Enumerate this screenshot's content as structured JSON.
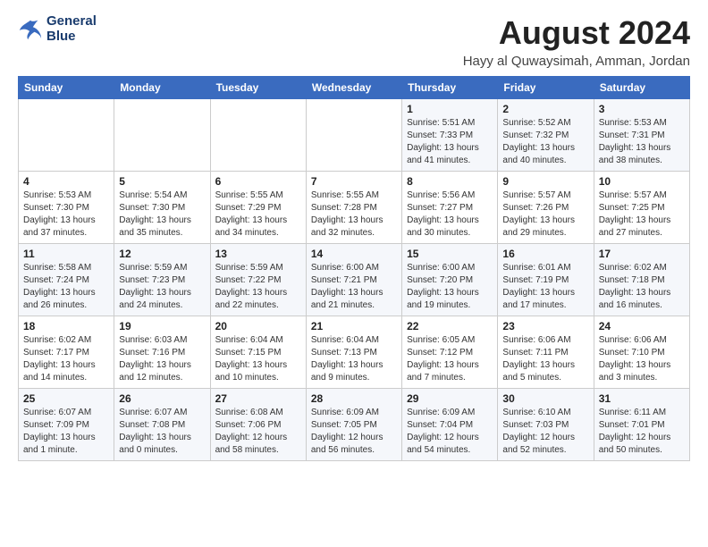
{
  "header": {
    "logo_line1": "General",
    "logo_line2": "Blue",
    "month_title": "August 2024",
    "location": "Hayy al Quwaysimah, Amman, Jordan"
  },
  "weekdays": [
    "Sunday",
    "Monday",
    "Tuesday",
    "Wednesday",
    "Thursday",
    "Friday",
    "Saturday"
  ],
  "weeks": [
    [
      {
        "day": "",
        "info": ""
      },
      {
        "day": "",
        "info": ""
      },
      {
        "day": "",
        "info": ""
      },
      {
        "day": "",
        "info": ""
      },
      {
        "day": "1",
        "info": "Sunrise: 5:51 AM\nSunset: 7:33 PM\nDaylight: 13 hours\nand 41 minutes."
      },
      {
        "day": "2",
        "info": "Sunrise: 5:52 AM\nSunset: 7:32 PM\nDaylight: 13 hours\nand 40 minutes."
      },
      {
        "day": "3",
        "info": "Sunrise: 5:53 AM\nSunset: 7:31 PM\nDaylight: 13 hours\nand 38 minutes."
      }
    ],
    [
      {
        "day": "4",
        "info": "Sunrise: 5:53 AM\nSunset: 7:30 PM\nDaylight: 13 hours\nand 37 minutes."
      },
      {
        "day": "5",
        "info": "Sunrise: 5:54 AM\nSunset: 7:30 PM\nDaylight: 13 hours\nand 35 minutes."
      },
      {
        "day": "6",
        "info": "Sunrise: 5:55 AM\nSunset: 7:29 PM\nDaylight: 13 hours\nand 34 minutes."
      },
      {
        "day": "7",
        "info": "Sunrise: 5:55 AM\nSunset: 7:28 PM\nDaylight: 13 hours\nand 32 minutes."
      },
      {
        "day": "8",
        "info": "Sunrise: 5:56 AM\nSunset: 7:27 PM\nDaylight: 13 hours\nand 30 minutes."
      },
      {
        "day": "9",
        "info": "Sunrise: 5:57 AM\nSunset: 7:26 PM\nDaylight: 13 hours\nand 29 minutes."
      },
      {
        "day": "10",
        "info": "Sunrise: 5:57 AM\nSunset: 7:25 PM\nDaylight: 13 hours\nand 27 minutes."
      }
    ],
    [
      {
        "day": "11",
        "info": "Sunrise: 5:58 AM\nSunset: 7:24 PM\nDaylight: 13 hours\nand 26 minutes."
      },
      {
        "day": "12",
        "info": "Sunrise: 5:59 AM\nSunset: 7:23 PM\nDaylight: 13 hours\nand 24 minutes."
      },
      {
        "day": "13",
        "info": "Sunrise: 5:59 AM\nSunset: 7:22 PM\nDaylight: 13 hours\nand 22 minutes."
      },
      {
        "day": "14",
        "info": "Sunrise: 6:00 AM\nSunset: 7:21 PM\nDaylight: 13 hours\nand 21 minutes."
      },
      {
        "day": "15",
        "info": "Sunrise: 6:00 AM\nSunset: 7:20 PM\nDaylight: 13 hours\nand 19 minutes."
      },
      {
        "day": "16",
        "info": "Sunrise: 6:01 AM\nSunset: 7:19 PM\nDaylight: 13 hours\nand 17 minutes."
      },
      {
        "day": "17",
        "info": "Sunrise: 6:02 AM\nSunset: 7:18 PM\nDaylight: 13 hours\nand 16 minutes."
      }
    ],
    [
      {
        "day": "18",
        "info": "Sunrise: 6:02 AM\nSunset: 7:17 PM\nDaylight: 13 hours\nand 14 minutes."
      },
      {
        "day": "19",
        "info": "Sunrise: 6:03 AM\nSunset: 7:16 PM\nDaylight: 13 hours\nand 12 minutes."
      },
      {
        "day": "20",
        "info": "Sunrise: 6:04 AM\nSunset: 7:15 PM\nDaylight: 13 hours\nand 10 minutes."
      },
      {
        "day": "21",
        "info": "Sunrise: 6:04 AM\nSunset: 7:13 PM\nDaylight: 13 hours\nand 9 minutes."
      },
      {
        "day": "22",
        "info": "Sunrise: 6:05 AM\nSunset: 7:12 PM\nDaylight: 13 hours\nand 7 minutes."
      },
      {
        "day": "23",
        "info": "Sunrise: 6:06 AM\nSunset: 7:11 PM\nDaylight: 13 hours\nand 5 minutes."
      },
      {
        "day": "24",
        "info": "Sunrise: 6:06 AM\nSunset: 7:10 PM\nDaylight: 13 hours\nand 3 minutes."
      }
    ],
    [
      {
        "day": "25",
        "info": "Sunrise: 6:07 AM\nSunset: 7:09 PM\nDaylight: 13 hours\nand 1 minute."
      },
      {
        "day": "26",
        "info": "Sunrise: 6:07 AM\nSunset: 7:08 PM\nDaylight: 13 hours\nand 0 minutes."
      },
      {
        "day": "27",
        "info": "Sunrise: 6:08 AM\nSunset: 7:06 PM\nDaylight: 12 hours\nand 58 minutes."
      },
      {
        "day": "28",
        "info": "Sunrise: 6:09 AM\nSunset: 7:05 PM\nDaylight: 12 hours\nand 56 minutes."
      },
      {
        "day": "29",
        "info": "Sunrise: 6:09 AM\nSunset: 7:04 PM\nDaylight: 12 hours\nand 54 minutes."
      },
      {
        "day": "30",
        "info": "Sunrise: 6:10 AM\nSunset: 7:03 PM\nDaylight: 12 hours\nand 52 minutes."
      },
      {
        "day": "31",
        "info": "Sunrise: 6:11 AM\nSunset: 7:01 PM\nDaylight: 12 hours\nand 50 minutes."
      }
    ]
  ]
}
